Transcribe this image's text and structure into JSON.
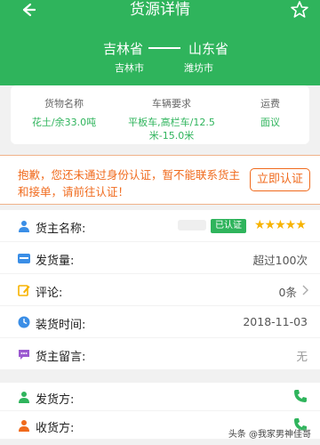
{
  "header": {
    "title": "货源详情"
  },
  "route": {
    "from_province": "吉林省",
    "to_province": "山东省",
    "from_city": "吉林市",
    "to_city": "潍坊市"
  },
  "cargo": {
    "goods_label": "货物名称",
    "goods_value": "花土/余33.0吨",
    "vehicle_label": "车辆要求",
    "vehicle_value": "平板车,高栏车/12.5米-15.0米",
    "fee_label": "运费",
    "fee_value": "面议"
  },
  "notice": {
    "text": "抱歉，您还未通过身份认证，暂不能联系货主和接单，请前往认证！",
    "button_label": "立即认证"
  },
  "info": {
    "owner_label": "货主名称:",
    "verified_badge": "已认证",
    "rating_stars": "★★★★★",
    "shipments_label": "发货量:",
    "shipments_value": "超过100次",
    "comments_label": "评论:",
    "comments_value": "0条",
    "load_time_label": "装货时间:",
    "load_time_value": "2018-11-03",
    "message_label": "货主留言:",
    "message_value": "无"
  },
  "contacts": {
    "sender_label": "发货方:",
    "receiver_label": "收货方:"
  },
  "watermark": "头条 @我家男神佳哥",
  "colors": {
    "brand": "#2fb45c",
    "warning": "#f06a1c",
    "star": "#f7b300"
  }
}
